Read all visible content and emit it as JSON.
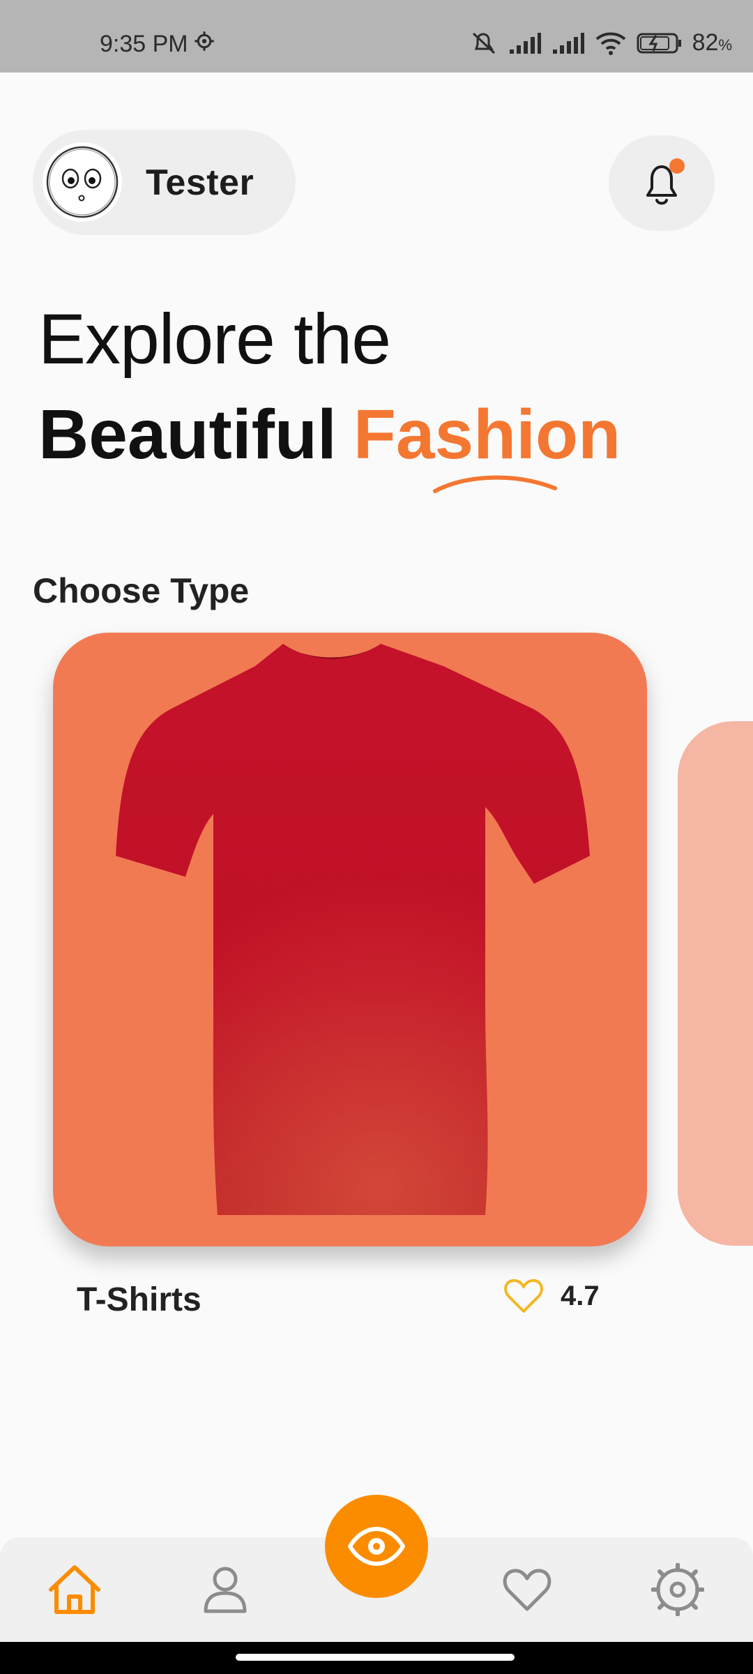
{
  "status_bar": {
    "time": "9:35 PM",
    "battery": "82",
    "battery_unit": "%"
  },
  "header": {
    "user_name": "Tester",
    "notification_dot_color": "#f47731"
  },
  "headline": {
    "line1": "Explore the",
    "line2_main": "Beautiful",
    "line2_accent": "Fashion",
    "accent_color": "#f47731"
  },
  "section": {
    "title": "Choose Type"
  },
  "cards": [
    {
      "label": "T-Shirts",
      "rating": "4.7",
      "background": "#f27a53"
    }
  ],
  "bottom_nav": {
    "items": [
      {
        "icon": "home-icon",
        "active": true
      },
      {
        "icon": "profile-icon",
        "active": false
      },
      {
        "icon": "eye-icon",
        "center": true
      },
      {
        "icon": "heart-icon",
        "active": false
      },
      {
        "icon": "settings-icon",
        "active": false
      }
    ],
    "active_color": "#fb8c00",
    "inactive_color": "#8c8c8c"
  }
}
